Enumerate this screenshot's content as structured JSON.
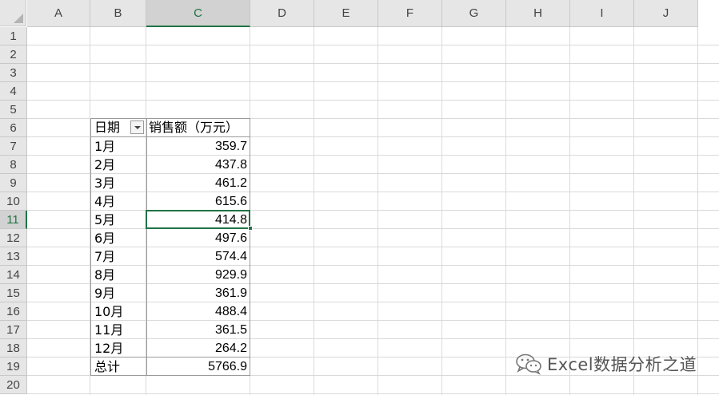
{
  "columns": [
    "A",
    "B",
    "C",
    "D",
    "E",
    "F",
    "G",
    "H",
    "I",
    "J"
  ],
  "rows": [
    "1",
    "2",
    "3",
    "4",
    "5",
    "6",
    "7",
    "8",
    "9",
    "10",
    "11",
    "12",
    "13",
    "14",
    "15",
    "16",
    "17",
    "18",
    "19",
    "20"
  ],
  "selected_column": "C",
  "selected_row": "11",
  "pivot": {
    "header_date": "日期",
    "header_sales": "销售额（万元）",
    "months": [
      "1月",
      "2月",
      "3月",
      "4月",
      "5月",
      "6月",
      "7月",
      "8月",
      "9月",
      "10月",
      "11月",
      "12月"
    ],
    "values": [
      "359.7",
      "437.8",
      "461.2",
      "615.6",
      "414.8",
      "497.6",
      "574.4",
      "929.9",
      "361.9",
      "488.4",
      "361.5",
      "264.2"
    ],
    "total_label": "总计",
    "total_value": "5766.9"
  },
  "watermark": {
    "text": "Excel数据分析之道",
    "icon": "wechat-icon"
  },
  "colors": {
    "selection": "#217346"
  }
}
